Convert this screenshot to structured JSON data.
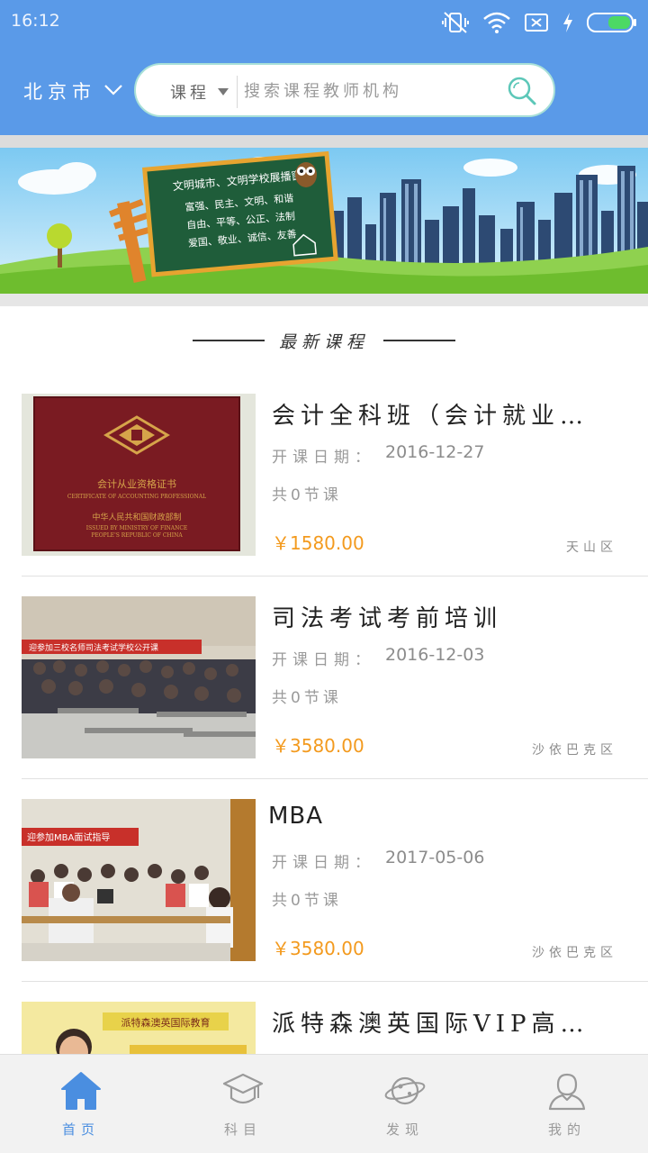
{
  "status_bar": {
    "time": "16:12",
    "icons": [
      "mute-vibrate-icon",
      "wifi-icon",
      "no-sim-icon",
      "charging-icon",
      "battery-icon"
    ],
    "battery_color": "#4cd964"
  },
  "header": {
    "city": "北京市",
    "search": {
      "type": "课程",
      "placeholder": "搜索课程教师机构"
    },
    "background_color": "#5a9ae8"
  },
  "banner": {
    "board_title": "文明城市、文明学校展播窗",
    "board_lines": [
      "富强、民主、文明、和谐",
      "自由、平等、公正、法制",
      "爱国、敬业、诚信、友善"
    ]
  },
  "section": {
    "title": "最新课程"
  },
  "courses": [
    {
      "title": "会计全科班（会计就业…",
      "date_label": "开课日期：",
      "date": "2016-12-27",
      "lessons": "共0节课",
      "price": "￥1580.00",
      "area": "天山区",
      "thumb": {
        "title": "会计从业资格证书",
        "subtitle": "CERTIFICATE OF ACCOUNTING PROFESSIONAL",
        "issuer": "中华人民共和国财政部制",
        "issuer_en1": "ISSUED BY MINISTRY OF FINANCE",
        "issuer_en2": "PEOPLE'S REPUBLIC OF CHINA"
      }
    },
    {
      "title": "司法考试考前培训",
      "date_label": "开课日期：",
      "date": "2016-12-03",
      "lessons": "共0节课",
      "price": "￥3580.00",
      "area": "沙依巴克区",
      "thumb": {
        "banner": "迎参加三校名师司法考试学校公开课"
      }
    },
    {
      "title": "MBA",
      "date_label": "开课日期：",
      "date": "2017-05-06",
      "lessons": "共0节课",
      "price": "￥3580.00",
      "area": "沙依巴克区",
      "thumb": {
        "banner": "迎参加MBA面试指导"
      }
    },
    {
      "title": "派特森澳英国际VIP高…",
      "date_label": "",
      "date": "",
      "lessons": "",
      "price": "",
      "area": "",
      "thumb": {
        "banner": "派特森澳英国际教育"
      }
    }
  ],
  "bottom_nav": [
    {
      "label": "首页",
      "icon": "home-icon",
      "active": true
    },
    {
      "label": "科目",
      "icon": "graduation-cap-icon",
      "active": false
    },
    {
      "label": "发现",
      "icon": "planet-icon",
      "active": false
    },
    {
      "label": "我的",
      "icon": "user-icon",
      "active": false
    }
  ],
  "colors": {
    "accent": "#4a8ee0",
    "price": "#f39a1e",
    "search_border": "#a8e0d8",
    "search_icon": "#5cc7b8"
  }
}
